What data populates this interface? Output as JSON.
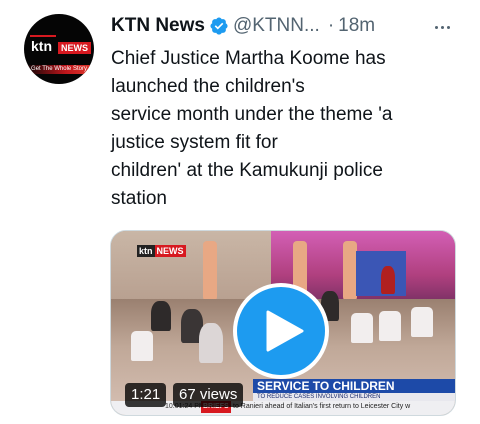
{
  "author": {
    "name": "KTN News",
    "handle": "@KTNN...",
    "separator": "·",
    "time": "18m",
    "avatar": {
      "logo_ktn": "ktn",
      "logo_news": "NEWS",
      "tagline": "Get The Whole Story"
    }
  },
  "tweet": {
    "text_lines": [
      "Chief Justice Martha Koome has",
      "launched the children's",
      "service month under the theme 'a",
      "justice system fit for",
      "children' at the Kamukunji police",
      "station"
    ]
  },
  "media": {
    "duration": "1:21",
    "views": "67 views",
    "channel_bug": {
      "ktn": "ktn",
      "news": "NEWS"
    },
    "banner_title": "SERVICE TO CHILDREN",
    "banner_sub": "TO REDUCE CASES INVOLVING CHILDREN",
    "ticker_time": "10:01:24 PM",
    "ticker_label": "BRIEFS",
    "ticker_text": "to Ranieri ahead of Italian's first return to Leicester City w"
  },
  "colors": {
    "accent": "#1d9bf0",
    "text_primary": "#0f1419",
    "text_secondary": "#536471",
    "brand_red": "#d71920"
  },
  "icons": {
    "verified": "verified-badge-icon",
    "more": "more-horizontal-icon",
    "play": "play-icon"
  }
}
